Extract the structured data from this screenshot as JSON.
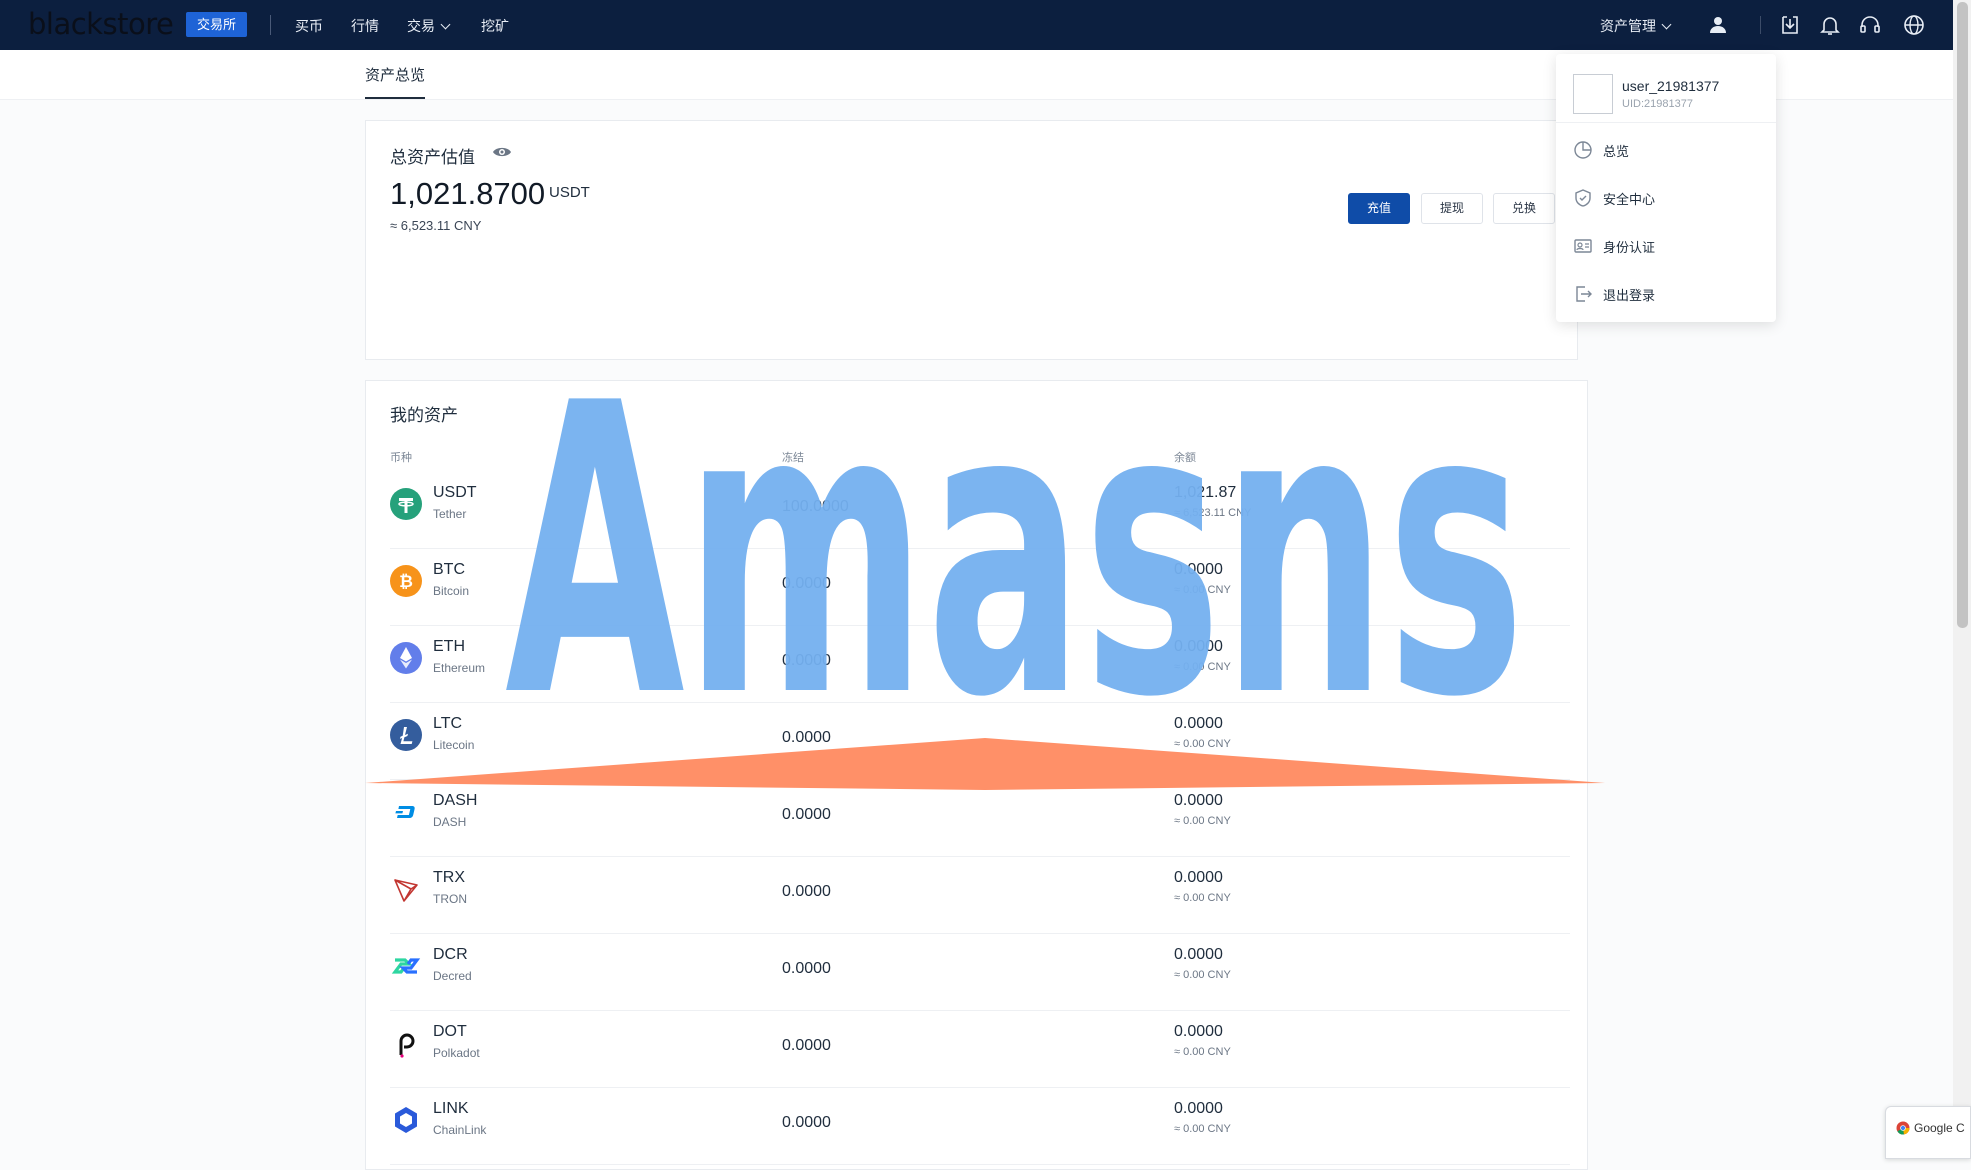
{
  "nav": {
    "logo": "blackstore",
    "badge": "交易所",
    "links": [
      "买币",
      "行情",
      "交易",
      "挖矿"
    ],
    "asset_menu": "资产管理"
  },
  "subnav": {
    "active_tab": "资产总览"
  },
  "overview": {
    "title": "总资产估值",
    "amount": "1,021.8700",
    "unit": "USDT",
    "approx": "≈ 6,523.11 CNY",
    "buttons": {
      "deposit": "充值",
      "withdraw": "提现",
      "exchange": "兑换"
    }
  },
  "assets": {
    "title": "我的资产",
    "columns": [
      "币种",
      "冻结",
      "余额"
    ],
    "rows": [
      {
        "symbol": "USDT",
        "name": "Tether",
        "frozen": "100.0000",
        "balance": "1,021.87",
        "cny": "≈ 6,523.11 CNY",
        "icon": "tether-icon",
        "color": "#26a17b"
      },
      {
        "symbol": "BTC",
        "name": "Bitcoin",
        "frozen": "0.0000",
        "balance": "0.0000",
        "cny": "≈ 0.00 CNY",
        "icon": "bitcoin-icon",
        "color": "#f7931a"
      },
      {
        "symbol": "ETH",
        "name": "Ethereum",
        "frozen": "0.0000",
        "balance": "0.0000",
        "cny": "≈ 0.00 CNY",
        "icon": "ethereum-icon",
        "color": "#627eea"
      },
      {
        "symbol": "LTC",
        "name": "Litecoin",
        "frozen": "0.0000",
        "balance": "0.0000",
        "cny": "≈ 0.00 CNY",
        "icon": "litecoin-icon",
        "color": "#345d9d"
      },
      {
        "symbol": "DASH",
        "name": "DASH",
        "frozen": "0.0000",
        "balance": "0.0000",
        "cny": "≈ 0.00 CNY",
        "icon": "dash-icon",
        "color": "#008de4"
      },
      {
        "symbol": "TRX",
        "name": "TRON",
        "frozen": "0.0000",
        "balance": "0.0000",
        "cny": "≈ 0.00 CNY",
        "icon": "tron-icon",
        "color": "#c23631"
      },
      {
        "symbol": "DCR",
        "name": "Decred",
        "frozen": "0.0000",
        "balance": "0.0000",
        "cny": "≈ 0.00 CNY",
        "icon": "decred-icon",
        "color": "#2ed6a1"
      },
      {
        "symbol": "DOT",
        "name": "Polkadot",
        "frozen": "0.0000",
        "balance": "0.0000",
        "cny": "≈ 0.00 CNY",
        "icon": "polkadot-icon",
        "color": "#111111"
      },
      {
        "symbol": "LINK",
        "name": "ChainLink",
        "frozen": "0.0000",
        "balance": "0.0000",
        "cny": "≈ 0.00 CNY",
        "icon": "chainlink-icon",
        "color": "#2a5ada"
      }
    ]
  },
  "user_menu": {
    "username": "user_21981377",
    "uid": "UID:21981377",
    "items": [
      "总览",
      "安全中心",
      "身份认证",
      "退出登录"
    ]
  },
  "watermark": {
    "text": "Amasns",
    "colors": {
      "text": "#74b0f0",
      "bar": "#ff8a60"
    }
  },
  "toast": {
    "text": "Google C"
  }
}
